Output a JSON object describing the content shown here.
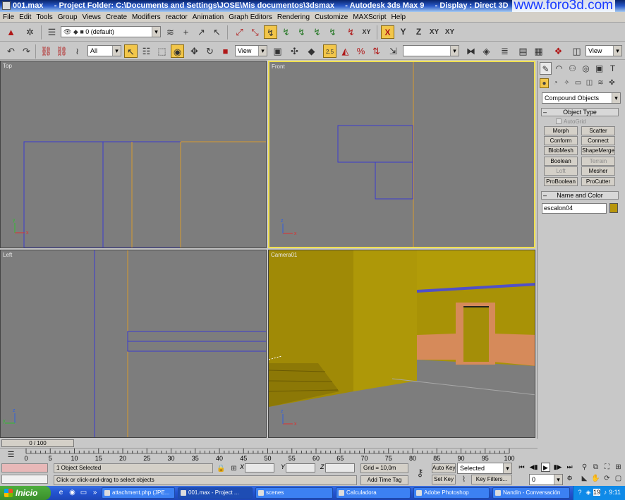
{
  "window": {
    "file": "001.max",
    "project_folder": "- Project Folder: C:\\Documents and Settings\\JOSE\\Mis documentos\\3dsmax",
    "app": "- Autodesk 3ds Max 9",
    "display": "- Display : Direct 3D",
    "watermark": "www.foro3d.com"
  },
  "menu": [
    "File",
    "Edit",
    "Tools",
    "Group",
    "Views",
    "Create",
    "Modifiers",
    "reactor",
    "Animation",
    "Graph Editors",
    "Rendering",
    "Customize",
    "MAXScript",
    "Help"
  ],
  "toolbar": {
    "layer_value": "0 (default)",
    "selection_filter": "All",
    "ref_coord": "View",
    "snap_value": "2.5",
    "named_sel": "",
    "view_right": "View",
    "axis_x": "X",
    "axis_y": "Y",
    "axis_z": "Z",
    "axis_xy": "XY",
    "axis_xy2": "XY"
  },
  "viewports": {
    "top": "Top",
    "front": "Front",
    "left": "Left",
    "camera": "Camera01",
    "axis_x": "x",
    "axis_y": "y",
    "axis_z": "z"
  },
  "command_panel": {
    "category": "Compound Objects",
    "object_type_title": "Object Type",
    "autogrid": "AutoGrid",
    "buttons": [
      "Morph",
      "Scatter",
      "Conform",
      "Connect",
      "BlobMesh",
      "ShapeMerge",
      "Boolean",
      "Terrain",
      "Loft",
      "Mesher",
      "ProBoolean",
      "ProCutter"
    ],
    "name_color_title": "Name and Color",
    "object_name": "escalon04",
    "object_color": "#b8960c"
  },
  "timeline": {
    "frame_counter": "0 / 100",
    "ticks": [
      "0",
      "5",
      "10",
      "15",
      "20",
      "25",
      "30",
      "35",
      "40",
      "45",
      "50",
      "55",
      "60",
      "65",
      "70",
      "75",
      "80",
      "85",
      "90",
      "95",
      "100"
    ]
  },
  "status": {
    "selection": "1 Object Selected",
    "prompt": "Click or click-and-drag to select objects",
    "x_label": "X",
    "y_label": "Y",
    "z_label": "Z",
    "grid": "Grid = 10,0m",
    "add_time_tag": "Add Time Tag",
    "auto_key": "Auto Key",
    "set_key": "Set Key",
    "key_mode": "Selected",
    "key_filters": "Key Filters...",
    "current_frame": "0"
  },
  "taskbar": {
    "start": "Inicio",
    "tasks": [
      "attachment.php (JPE...",
      "001.max     - Project ...",
      "scenes",
      "Calculadora",
      "Adobe Photoshop",
      "Nandin - Conversación"
    ],
    "tray_badge": "19",
    "clock": "9:11"
  }
}
